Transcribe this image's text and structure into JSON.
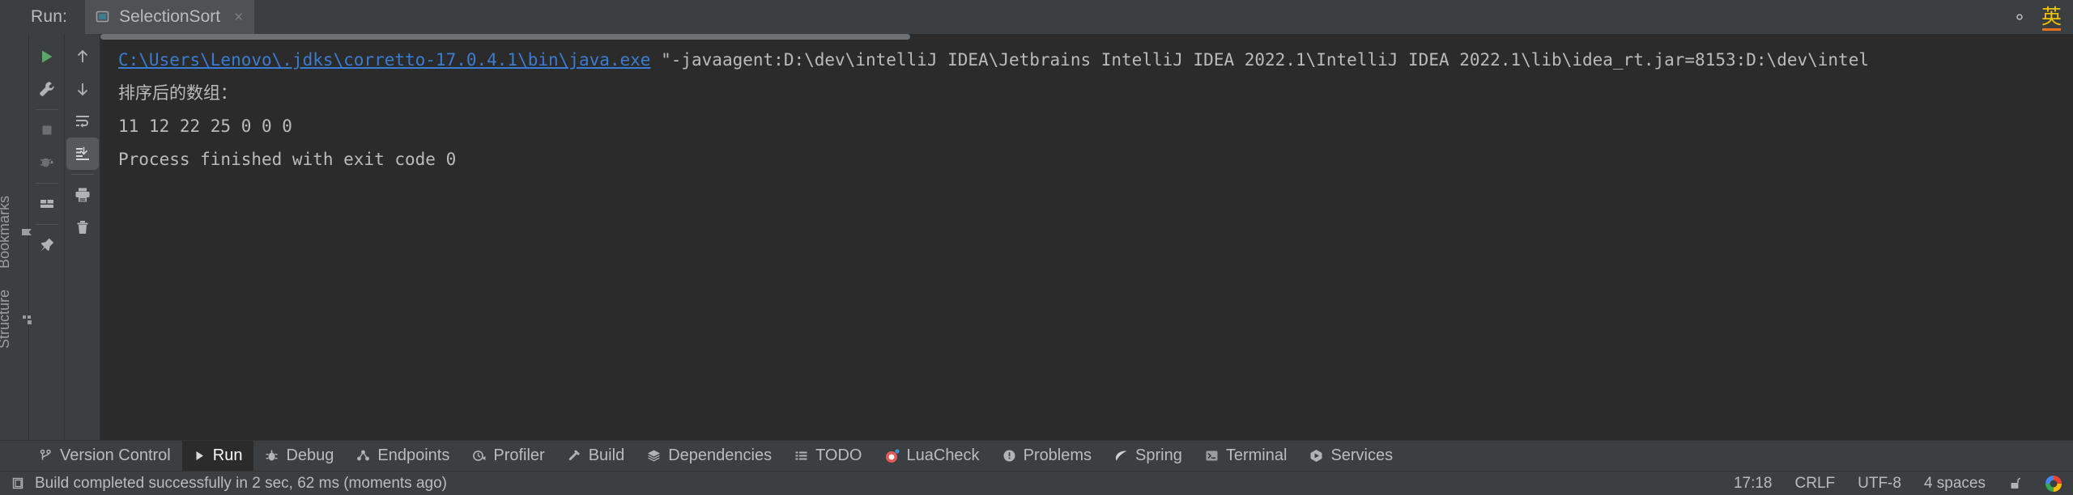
{
  "window": {
    "run_label": "Run:",
    "tab_title": "SelectionSort",
    "tab_close": "×",
    "ime_indicator": "英"
  },
  "colors": {
    "accent_link": "#3a7cd1",
    "run_green": "#5a9c4a",
    "ime_yellow": "#f0c400",
    "ime_orange": "#e8731a",
    "panel_bg": "#3c3f41",
    "console_bg": "#2b2b2b",
    "text": "#bbbbbb"
  },
  "side_strip": {
    "items": [
      {
        "label": "Bookmarks",
        "icon": "bookmark-icon"
      },
      {
        "label": "Structure",
        "icon": "structure-icon"
      }
    ]
  },
  "run_toolbar": {
    "items": [
      {
        "name": "rerun-button",
        "icon": "play-icon"
      },
      {
        "name": "edit-configurations-button",
        "icon": "wrench-icon"
      },
      {
        "name": "stop-button",
        "icon": "stop-icon"
      },
      {
        "name": "rerun-failed-tests-button",
        "icon": "debug-rerun-icon"
      },
      {
        "name": "layout-settings-button",
        "icon": "layout-icon"
      },
      {
        "name": "pin-tab-button",
        "icon": "pin-icon"
      }
    ]
  },
  "console_toolbar": {
    "items": [
      {
        "name": "previous-occurrence-button",
        "icon": "arrow-up-icon"
      },
      {
        "name": "next-occurrence-button",
        "icon": "arrow-down-icon"
      },
      {
        "name": "soft-wrap-button",
        "icon": "soft-wrap-icon"
      },
      {
        "name": "scroll-to-end-button",
        "icon": "scroll-to-end-icon",
        "active": true
      },
      {
        "name": "print-button",
        "icon": "print-icon"
      },
      {
        "name": "clear-all-button",
        "icon": "trash-icon"
      }
    ]
  },
  "console": {
    "command_link": "C:\\Users\\Lenovo\\.jdks\\corretto-17.0.4.1\\bin\\java.exe",
    "command_args": " \"-javaagent:D:\\dev\\intelliJ IDEA\\Jetbrains IntelliJ IDEA 2022.1\\IntelliJ IDEA 2022.1\\lib\\idea_rt.jar=8153:D:\\dev\\intel",
    "output_lines": [
      "排序后的数组：",
      "11 12 22 25 0 0 0",
      "Process finished with exit code 0"
    ]
  },
  "tool_window_bar": {
    "items": [
      {
        "label": "Version Control",
        "icon": "branch-icon",
        "active": false
      },
      {
        "label": "Run",
        "icon": "play-icon",
        "active": true
      },
      {
        "label": "Debug",
        "icon": "bug-icon",
        "active": false
      },
      {
        "label": "Endpoints",
        "icon": "endpoints-icon",
        "active": false
      },
      {
        "label": "Profiler",
        "icon": "profiler-icon",
        "active": false
      },
      {
        "label": "Build",
        "icon": "hammer-icon",
        "active": false
      },
      {
        "label": "Dependencies",
        "icon": "layers-icon",
        "active": false
      },
      {
        "label": "TODO",
        "icon": "list-icon",
        "active": false
      },
      {
        "label": "LuaCheck",
        "icon": "luacheck-icon",
        "active": false
      },
      {
        "label": "Problems",
        "icon": "warning-icon",
        "active": false
      },
      {
        "label": "Spring",
        "icon": "leaf-icon",
        "active": false
      },
      {
        "label": "Terminal",
        "icon": "terminal-icon",
        "active": false
      },
      {
        "label": "Services",
        "icon": "services-icon",
        "active": false
      }
    ]
  },
  "status_bar": {
    "build_message": "Build completed successfully in 2 sec, 62 ms (moments ago)",
    "time": "17:18",
    "line_separator": "CRLF",
    "encoding": "UTF-8",
    "indent": "4 spaces",
    "lock_icon": "unlock-icon",
    "account_icon": "google-icon"
  }
}
